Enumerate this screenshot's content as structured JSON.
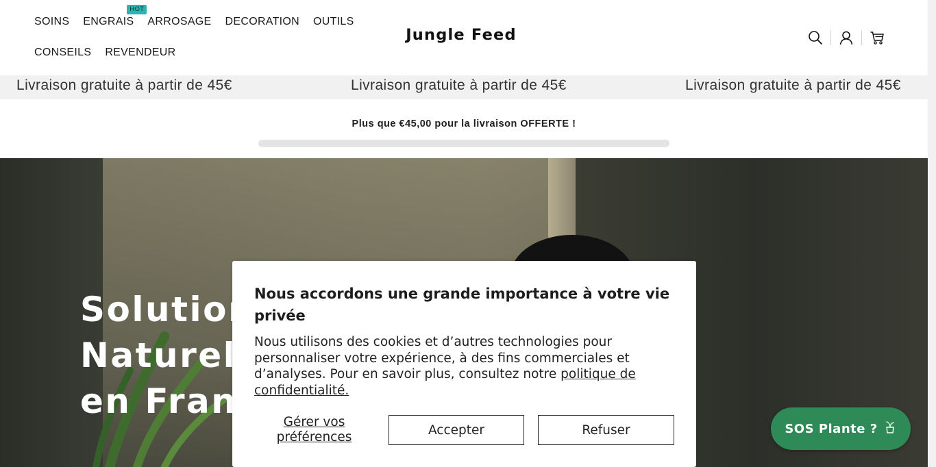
{
  "nav": {
    "row1": [
      "SOINS",
      "ENGRAIS",
      "ARROSAGE",
      "DECORATION",
      "OUTILS"
    ],
    "row2": [
      "CONSEILS",
      "REVENDEUR"
    ],
    "hot_badge": "HOT"
  },
  "logo": "Jungle Feed",
  "header_icons": [
    "search-icon",
    "account-icon",
    "cart-icon"
  ],
  "announcement": {
    "text": "Livraison gratuite à partir de 45€"
  },
  "shipping": {
    "message": "Plus que €45,00 pour la livraison OFFERTE !",
    "progress_percent": 0
  },
  "hero": {
    "title_lines": [
      "Solutions",
      "Naturelle",
      "en Franc"
    ]
  },
  "cookie": {
    "title": "Nous accordons une grande importance à votre vie privée",
    "body": "Nous utilisons des cookies et d’autres technologies pour personnaliser votre expérience, à des fins commerciales et d’analyses. Pour en savoir plus, consultez notre",
    "link": "politique de confidentialité.",
    "manage": "Gérer vos préférences",
    "accept": "Accepter",
    "refuse": "Refuser"
  },
  "sos": {
    "label": "SOS Plante ?",
    "icon": "plant-emoji-icon"
  },
  "colors": {
    "accent_green": "#2e8b57",
    "hot_badge": "#2bb3b3",
    "announce_bg": "#f1f1f1"
  }
}
